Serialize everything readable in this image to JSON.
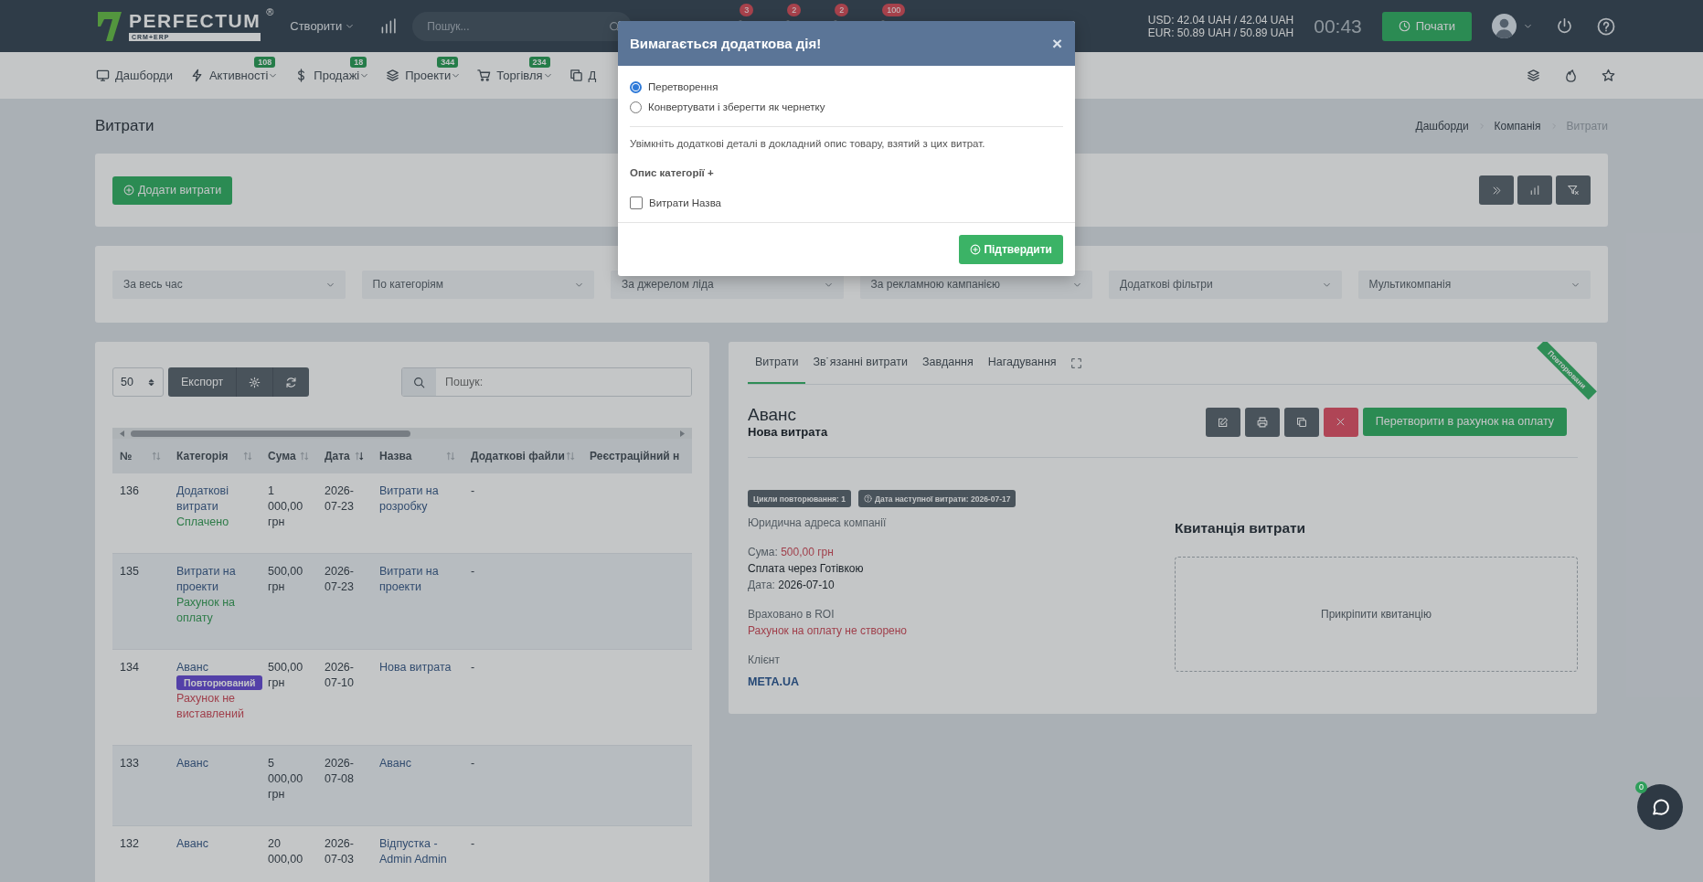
{
  "header": {
    "logo": {
      "name": "PERFECTUM",
      "registered": "®",
      "tagline": "CRM+ERP"
    },
    "create_menu": "Створити",
    "search": {
      "placeholder": "Пошук..."
    },
    "notifications": [
      {
        "badge": "3"
      },
      {
        "badge": "2"
      },
      {
        "badge": "2"
      },
      {
        "badge": "100"
      }
    ],
    "rates": [
      "USD: 42.04 UAH / 42.04 UAH",
      "EUR: 50.89 UAH / 50.89 UAH"
    ],
    "timer": "00:43",
    "start_button": "Почати"
  },
  "nav": {
    "items": [
      {
        "label": "Дашборди",
        "kind": "monitor",
        "dropdown": false
      },
      {
        "label": "Активності",
        "kind": "bolt",
        "badge": "108",
        "dropdown": true
      },
      {
        "label": "Продажі",
        "kind": "dollar",
        "badge": "18",
        "dropdown": true
      },
      {
        "label": "Проекти",
        "kind": "layers",
        "badge": "344",
        "dropdown": true
      },
      {
        "label": "Торгівля",
        "kind": "cart",
        "badge": "234",
        "dropdown": true
      },
      {
        "label": "Д",
        "kind": "copy",
        "dropdown": false
      }
    ]
  },
  "page": {
    "title": "Витрати",
    "breadcrumb": [
      {
        "label": "Дашборди",
        "current": false
      },
      {
        "label": "Компанія",
        "current": false
      },
      {
        "label": "Витрати",
        "current": true
      }
    ]
  },
  "toolbar": {
    "add_button": "Додати витрати"
  },
  "filters": [
    "За весь час",
    "По категоріям",
    "За джерелом ліда",
    "За рекламною кампанією",
    "Додаткові фільтри",
    "Мультикомпанія"
  ],
  "table": {
    "page_size": "50",
    "export_button": "Експорт",
    "search": {
      "placeholder": "Пошук:"
    },
    "columns": [
      {
        "label": "№",
        "sort_active": false
      },
      {
        "label": "Категорія",
        "sort_active": false
      },
      {
        "label": "Сума",
        "sort_active": false
      },
      {
        "label": "Дата",
        "sort_active": true
      },
      {
        "label": "Назва",
        "sort_active": false
      },
      {
        "label": "Додаткові файли",
        "sort_active": false
      },
      {
        "label": "Реєстраційний н"
      }
    ],
    "rows": [
      {
        "number": "136",
        "category": "Додаткові витрати",
        "status": {
          "text": "Сплачено",
          "kind": "success"
        },
        "amount": "1 000,00 грн",
        "date": "2026-07-23",
        "name": "Витрати на розробку",
        "files": "-"
      },
      {
        "number": "135",
        "category": "Витрати на проекти",
        "status": {
          "text": "Рахунок на оплату",
          "kind": "success"
        },
        "amount": "500,00 грн",
        "date": "2026-07-23",
        "name": "Витрати на проекти",
        "files": "-"
      },
      {
        "number": "134",
        "category": "Аванс",
        "badge": "Повторюваний",
        "status": {
          "text": "Рахунок не виставлений",
          "kind": "danger"
        },
        "amount": "500,00 грн",
        "date": "2026-07-10",
        "name": "Нова витрата",
        "files": "-"
      },
      {
        "number": "133",
        "category": "Аванс",
        "amount": "5 000,00 грн",
        "date": "2026-07-08",
        "name": "Аванс",
        "files": "-"
      },
      {
        "number": "132",
        "category": "Аванс",
        "amount": "20 000,00",
        "date": "2026-07-03",
        "name": "Відпустка - Admin Admin",
        "files": "-"
      }
    ]
  },
  "detail": {
    "tabs": [
      {
        "label": "Витрати",
        "selected": true
      },
      {
        "label": "Зв˙язанні витрати",
        "selected": false
      },
      {
        "label": "Завдання",
        "selected": false
      },
      {
        "label": "Нагадування",
        "selected": false
      }
    ],
    "ribbon": "Повторювани",
    "title": "Аванс",
    "subtitle": "Нова витрата",
    "convert_button": "Перетворити в рахунок на оплату",
    "tags": [
      {
        "text": "Цикли повторювання: 1",
        "kind": "plain"
      },
      {
        "text": "Дата наступної витрати: 2026-07-17",
        "kind": "info"
      }
    ],
    "info": {
      "company_address": "Юридична адреса компанії",
      "amount_label": "Сума:",
      "amount": "500,00 грн",
      "payment": "Сплата через Готівкою",
      "date_label": "Дата:",
      "date": "2026-07-10",
      "roi": "Враховано в ROI",
      "invoice_status": "Рахунок на оплату не створено",
      "client_label": "Клієнт",
      "client": "META.UA"
    },
    "receipt": {
      "title": "Квитанція витрати",
      "dropzone": "Прикріпити квитанцію"
    }
  },
  "chat": {
    "badge": "0"
  },
  "modal": {
    "title": "Вимагається додаткова дія!",
    "close": "×",
    "options": [
      {
        "label": "Перетворення",
        "selected": true
      },
      {
        "label": "Конвертувати і зберегти як чернетку",
        "selected": false
      }
    ],
    "description": "Увімкніть додаткові деталі в докладний опис товару, взятий з цих витрат.",
    "section_title": "Опис категорії +",
    "checkboxes": [
      {
        "label": "Витрати Назва",
        "checked": false
      }
    ],
    "confirm_button": "Підтвердити"
  }
}
